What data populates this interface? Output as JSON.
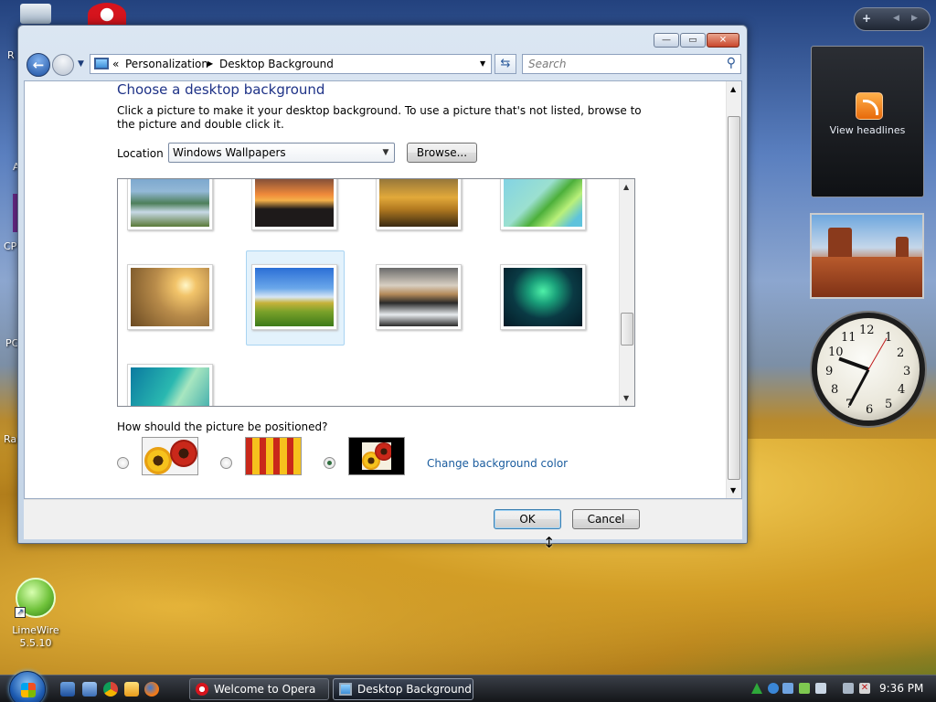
{
  "desktop": {
    "icons": [
      {
        "label": "LimeWire\n5.5.10",
        "name": "limewire-icon"
      }
    ],
    "clipped_labels": {
      "r1": "R",
      "r2": "A",
      "r3": "CP",
      "r4": "PC",
      "r5": "Ra"
    }
  },
  "sidebar": {
    "add_label": "+",
    "feed_label": "View headlines"
  },
  "clock_numbers": [
    "12",
    "1",
    "2",
    "3",
    "4",
    "5",
    "6",
    "7",
    "8",
    "9",
    "10",
    "11"
  ],
  "window": {
    "caption_buttons": {
      "minimize": "—",
      "maximize": "▭",
      "close": "✕"
    },
    "address": {
      "sep": "«",
      "crumb1": "Personalization",
      "arrow": "▶",
      "crumb2": "Desktop Background",
      "drop": "▼"
    },
    "refresh_icon": "refresh-icon",
    "search_placeholder": "Search",
    "heading": "Choose a desktop background",
    "description": "Click a picture to make it your desktop background. To use a picture that's not listed, browse to the picture and double click it.",
    "location_label": "Location",
    "location_value": "Windows Wallpapers",
    "browse_label": "Browse...",
    "position_question": "How should the picture be positioned?",
    "position_selected": "center",
    "change_color_link": "Change background color",
    "ok_label": "OK",
    "cancel_label": "Cancel",
    "selected_wallpaper": "green-hills"
  },
  "taskbar": {
    "tasks": [
      {
        "label": "Welcome to Opera",
        "active": false
      },
      {
        "label": "Desktop Background",
        "active": true
      }
    ],
    "time": "9:36 PM"
  }
}
